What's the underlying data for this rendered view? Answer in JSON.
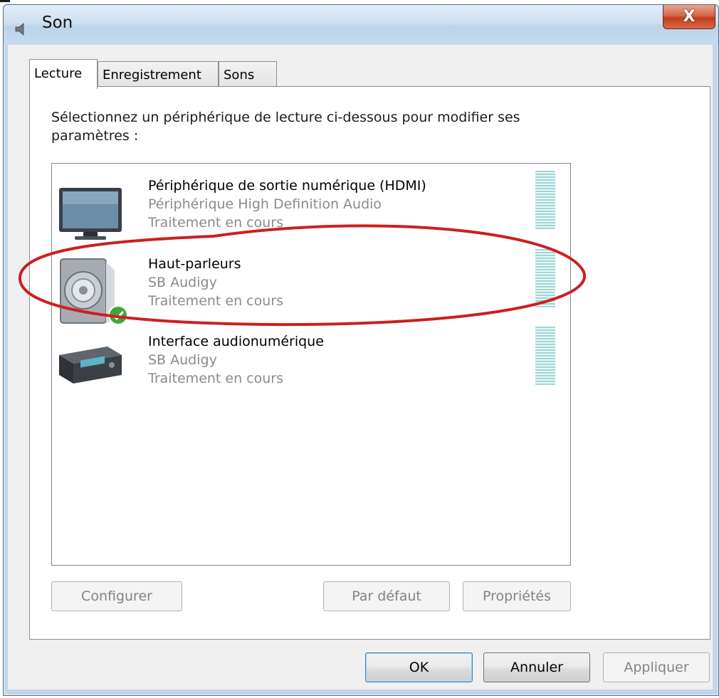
{
  "window": {
    "title": "Son",
    "close_label": "X"
  },
  "tabs": [
    {
      "label": "Lecture",
      "active": true
    },
    {
      "label": "Enregistrement",
      "active": false
    },
    {
      "label": "Sons",
      "active": false
    }
  ],
  "instruction": "Sélectionnez un périphérique de lecture ci-dessous pour modifier ses paramètres :",
  "devices": [
    {
      "name": "Périphérique de sortie numérique (HDMI)",
      "driver": "Périphérique High Definition Audio",
      "status": "Traitement en cours",
      "icon": "monitor-icon",
      "default": false
    },
    {
      "name": "Haut-parleurs",
      "driver": "SB Audigy",
      "status": "Traitement en cours",
      "icon": "speaker-icon",
      "default": true
    },
    {
      "name": "Interface audionumérique",
      "driver": "SB Audigy",
      "status": "Traitement en cours",
      "icon": "receiver-icon",
      "default": false
    }
  ],
  "panel_buttons": {
    "configure": "Configurer",
    "set_default": "Par défaut",
    "properties": "Propriétés"
  },
  "dialog_buttons": {
    "ok": "OK",
    "cancel": "Annuler",
    "apply": "Appliquer"
  },
  "colors": {
    "annotation": "#cc1f1f",
    "vu_meter": "#9fd7d7",
    "default_check": "#3fa63a"
  }
}
